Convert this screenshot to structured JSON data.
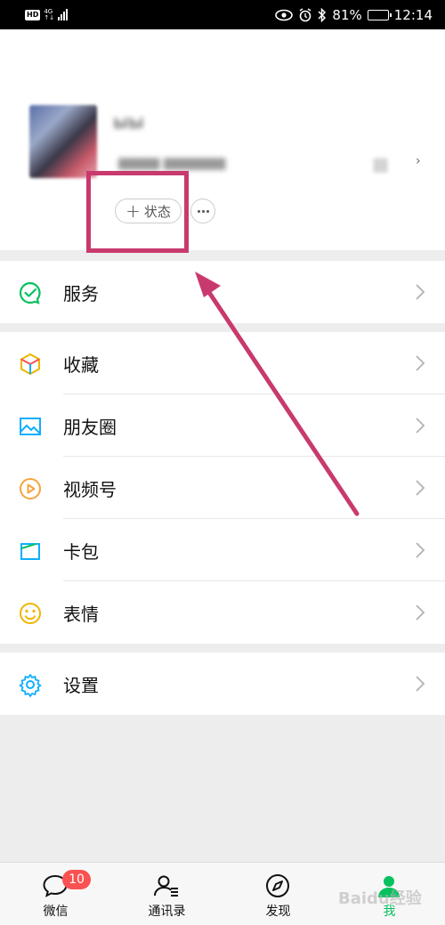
{
  "status_bar": {
    "hd": "HD",
    "network": "4G",
    "battery_percent": "81%",
    "battery_level": 0.81,
    "time": "12:14",
    "icons": [
      "eye-icon",
      "alarm-icon",
      "bluetooth-icon"
    ]
  },
  "profile": {
    "nickname": "ыы",
    "wechat_id": "▆▆▆▆ ▆▆▆▆▆▆",
    "status_button": "状态",
    "status_plus": "+"
  },
  "menu": {
    "service": "服务",
    "favorites": "收藏",
    "moments": "朋友圈",
    "channels": "视频号",
    "cards": "卡包",
    "stickers": "表情",
    "settings": "设置"
  },
  "tabs": [
    {
      "label": "微信",
      "badge": "10"
    },
    {
      "label": "通讯录"
    },
    {
      "label": "发现"
    },
    {
      "label": "我"
    }
  ],
  "watermark": "Baidu经验",
  "colors": {
    "accent": "#07c160",
    "highlight": "#c83a6e",
    "badge": "#fa5151"
  }
}
